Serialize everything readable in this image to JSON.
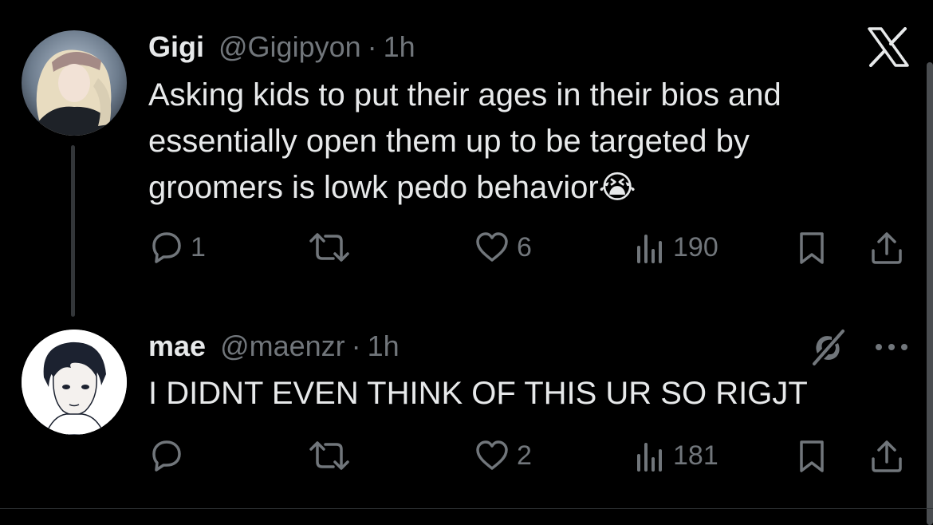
{
  "tweet1": {
    "display_name": "Gigi",
    "handle": "@Gigipyon",
    "separator": "·",
    "time": "1h",
    "text_line1": "Asking kids to put their ages in their bios and",
    "text_line2": "essentially open them up to be targeted by",
    "text_line3": "groomers is lowk pedo behavior",
    "emoji": "😭",
    "actions": {
      "reply_icon": "reply-icon",
      "reply_count": "1",
      "retweet_icon": "retweet-icon",
      "like_icon": "heart-icon",
      "like_count": "6",
      "views_icon": "views-icon",
      "view_count": "190",
      "bookmark_icon": "bookmark-icon",
      "share_icon": "share-icon"
    }
  },
  "tweet2": {
    "display_name": "mae",
    "handle": "@maenzr",
    "separator": "·",
    "time": "1h",
    "text_line1": "I DIDNT EVEN THINK OF THIS UR SO RIGJT",
    "grok_icon": "grok-icon",
    "more_icon": "more-icon",
    "actions": {
      "reply_icon": "reply-icon",
      "retweet_icon": "retweet-icon",
      "like_icon": "heart-icon",
      "like_count": "2",
      "views_icon": "views-icon",
      "view_count": "181",
      "bookmark_icon": "bookmark-icon",
      "share_icon": "share-icon"
    }
  },
  "header": {
    "logo_icon": "x-logo-icon"
  },
  "colors": {
    "background": "#000000",
    "text": "#e7e9ea",
    "muted": "#71767b",
    "thread_line": "#333639"
  }
}
